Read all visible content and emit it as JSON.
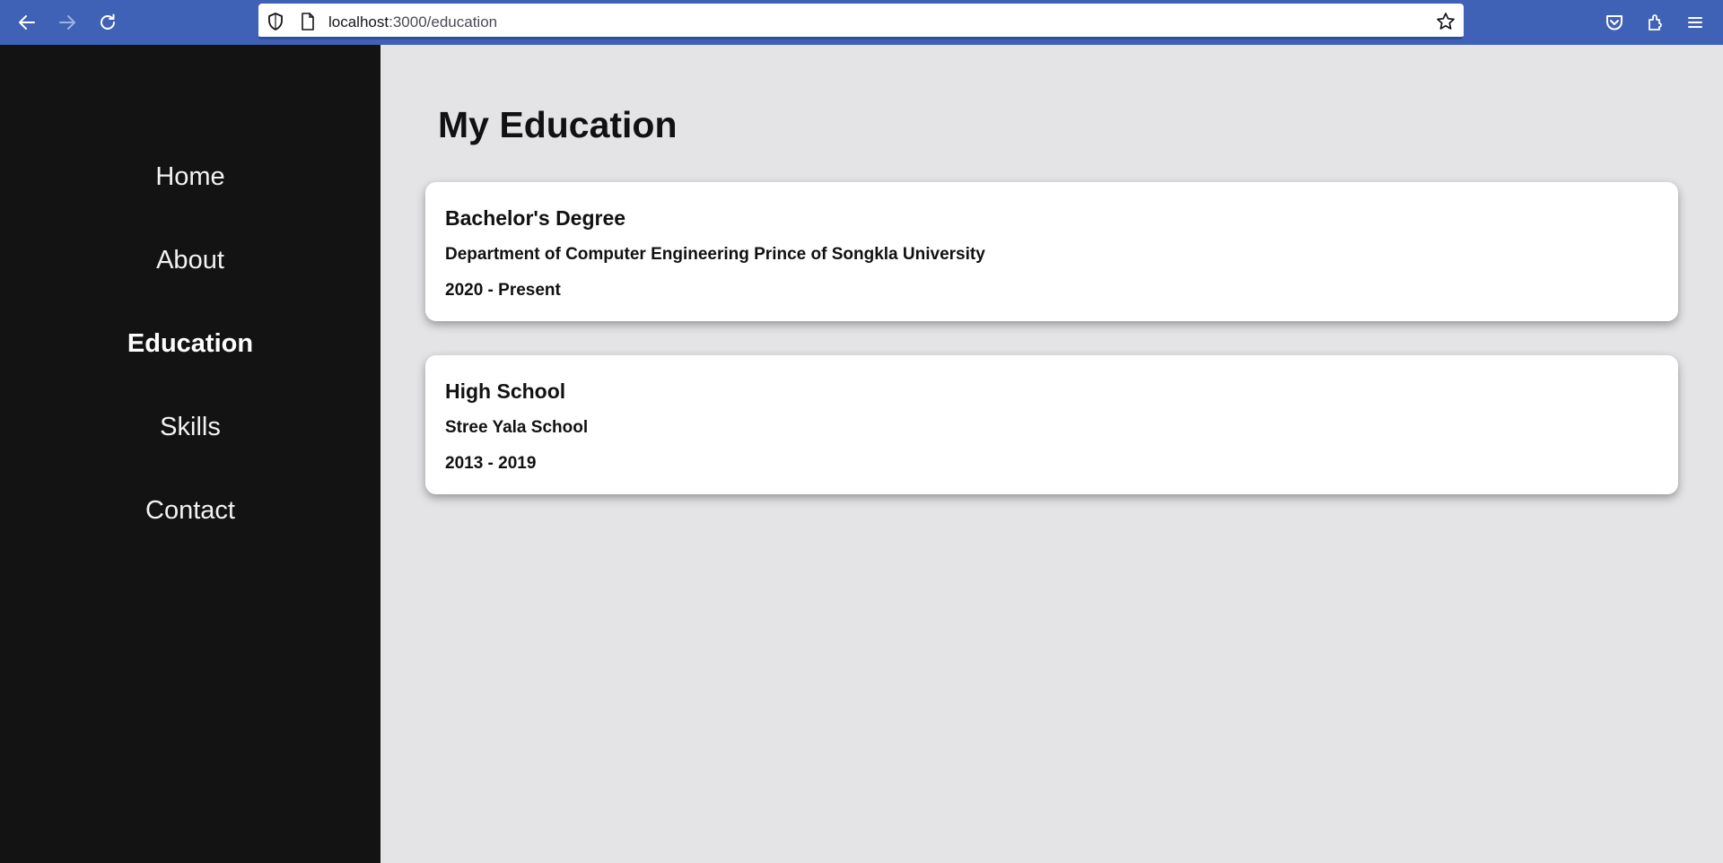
{
  "browser": {
    "url_host": "localhost",
    "url_path": ":3000/education",
    "icons": [
      "back-arrow-icon",
      "forward-arrow-icon",
      "reload-icon",
      "shield-icon",
      "page-icon",
      "star-icon",
      "pocket-icon",
      "extensions-icon",
      "menu-icon"
    ]
  },
  "sidebar": {
    "items": [
      {
        "label": "Home",
        "active": false
      },
      {
        "label": "About",
        "active": false
      },
      {
        "label": "Education",
        "active": true
      },
      {
        "label": "Skills",
        "active": false
      },
      {
        "label": "Contact",
        "active": false
      }
    ]
  },
  "main": {
    "title": "My Education",
    "cards": [
      {
        "degree": "Bachelor's Degree",
        "institution": "Department of Computer Engineering Prince of Songkla University",
        "years": "2020 - Present"
      },
      {
        "degree": "High School",
        "institution": "Stree Yala School",
        "years": "2013 - 2019"
      }
    ]
  },
  "colors": {
    "browser_bar": "#3f62b6",
    "sidebar_bg": "#131313",
    "main_bg": "#e4e4e6",
    "card_bg": "#ffffff"
  }
}
